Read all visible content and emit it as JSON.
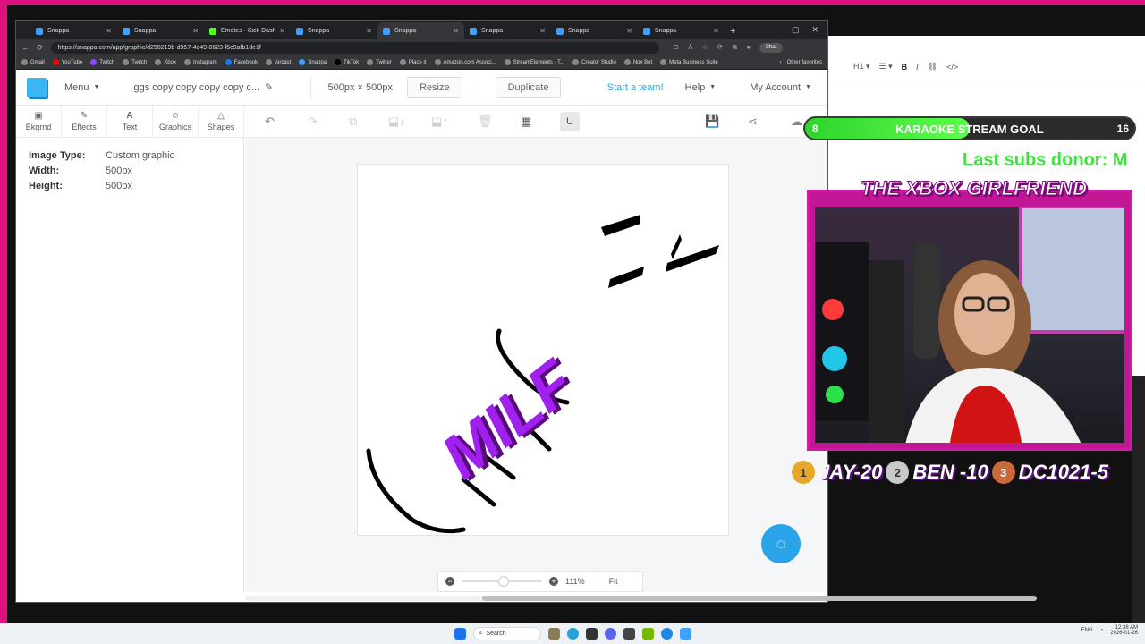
{
  "browser": {
    "tabs": [
      {
        "title": "Snappa",
        "kind": "snappa"
      },
      {
        "title": "Snappa",
        "kind": "snappa"
      },
      {
        "title": "Emotes · Kick Dashboard",
        "kind": "kick"
      },
      {
        "title": "Snappa",
        "kind": "snappa"
      },
      {
        "title": "Snappa",
        "kind": "snappa",
        "active": true
      },
      {
        "title": "Snappa",
        "kind": "snappa"
      },
      {
        "title": "Snappa",
        "kind": "snappa"
      },
      {
        "title": "Snappa",
        "kind": "snappa"
      }
    ],
    "url": "https://snappa.com/app/graphic/d258219b-d957-4d49-8623-f6c9afb1de1f",
    "copilot_label": "Chat",
    "bookmarks": [
      "Gmail",
      "YouTube",
      "Twitch",
      "Twitch",
      "Xbox",
      "Instagram",
      "Facebook",
      "Aircast",
      "Snappa",
      "TikTok",
      "Twitter",
      "Place it",
      "Amazon.com Associ...",
      "StreamElements · T...",
      "Creator Studio",
      "Nox Bot",
      "Meta Business Suite"
    ],
    "other_favorites": "Other favorites"
  },
  "header": {
    "menu": "Menu",
    "design_title": "ggs copy copy copy copy c...",
    "dimensions": "500px × 500px",
    "resize": "Resize",
    "duplicate": "Duplicate",
    "team": "Start a team!",
    "help": "Help",
    "account": "My Account"
  },
  "toolbar": {
    "tools": [
      {
        "label": "Bkgrnd",
        "icon": "background-icon"
      },
      {
        "label": "Effects",
        "icon": "effects-icon"
      },
      {
        "label": "Text",
        "icon": "text-icon"
      },
      {
        "label": "Graphics",
        "icon": "graphics-icon"
      },
      {
        "label": "Shapes",
        "icon": "shapes-icon"
      }
    ]
  },
  "properties": {
    "rows": [
      {
        "label": "Image Type:",
        "value": "Custom graphic"
      },
      {
        "label": "Width:",
        "value": "500px"
      },
      {
        "label": "Height:",
        "value": "500px"
      }
    ]
  },
  "canvas": {
    "artwork_text": "MILF",
    "zoom": "111%",
    "fit": "Fit",
    "zoom_level": 0.45
  },
  "stream": {
    "goal": {
      "label": "KARAOKE STREAM GOAL",
      "current": "8",
      "target": "16",
      "progress": 0.5
    },
    "donor": "Last subs donor: M",
    "cam_title": "THE XBOX GIRLFRIEND",
    "top": [
      {
        "rank": "1",
        "text": "JAY-20"
      },
      {
        "rank": "2",
        "text": "BEN -10"
      },
      {
        "rank": "3",
        "text": "DC1021-5"
      }
    ],
    "colors": {
      "frame": "#e0117f",
      "goal_fill": "#2ed32e",
      "donor": "#39e639"
    }
  },
  "taskbar": {
    "search": "Search",
    "time": "12:38 AM",
    "date": "2026-01-26",
    "lang": "ENG"
  }
}
